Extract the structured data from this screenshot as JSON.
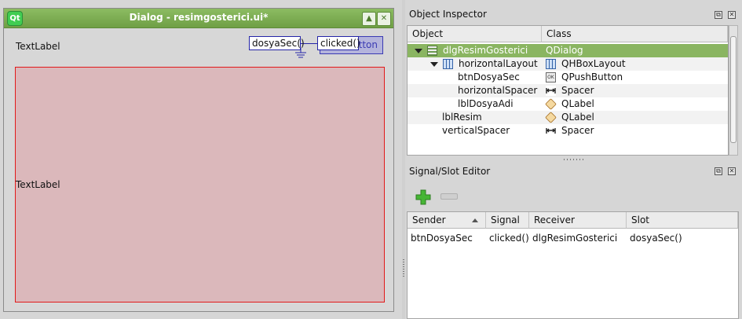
{
  "form": {
    "title": "Dialog - resimgosterici.ui*",
    "logo_text": "Qt",
    "title_buttons": [
      "▲",
      "✕"
    ],
    "top_label": "TextLabel",
    "button_text": "tton",
    "connection_slot": "dosyaSec()",
    "connection_signal": "clicked()",
    "image_label": "TextLabel",
    "image_label_bg": "#dbb8bb",
    "image_label_border": "#e11a1a"
  },
  "object_inspector": {
    "title": "Object Inspector",
    "columns": [
      "Object",
      "Class"
    ],
    "rows": [
      {
        "object": "dlgResimGosterici",
        "class": "QDialog",
        "icon": "dialog-icon",
        "expanded": true
      },
      {
        "object": "horizontalLayout",
        "class": "QHBoxLayout",
        "icon": "hbox-layout-icon",
        "expanded": true
      },
      {
        "object": "btnDosyaSec",
        "class": "QPushButton",
        "icon": "push-button-icon"
      },
      {
        "object": "horizontalSpacer",
        "class": "Spacer",
        "icon": "spacer-icon"
      },
      {
        "object": "lblDosyaAdi",
        "class": "QLabel",
        "icon": "label-icon"
      },
      {
        "object": "lblResim",
        "class": "QLabel",
        "icon": "label-icon"
      },
      {
        "object": "verticalSpacer",
        "class": "Spacer",
        "icon": "spacer-icon"
      }
    ],
    "selected_color": "#8ab561"
  },
  "signal_slot_editor": {
    "title": "Signal/Slot Editor",
    "columns": [
      "Sender",
      "Signal",
      "Receiver",
      "Slot"
    ],
    "rows": [
      {
        "sender": "btnDosyaSec",
        "signal": "clicked()",
        "receiver": "dlgResimGosterici",
        "slot": "dosyaSec()"
      }
    ]
  },
  "dock_buttons": [
    "⧉",
    "✕"
  ]
}
